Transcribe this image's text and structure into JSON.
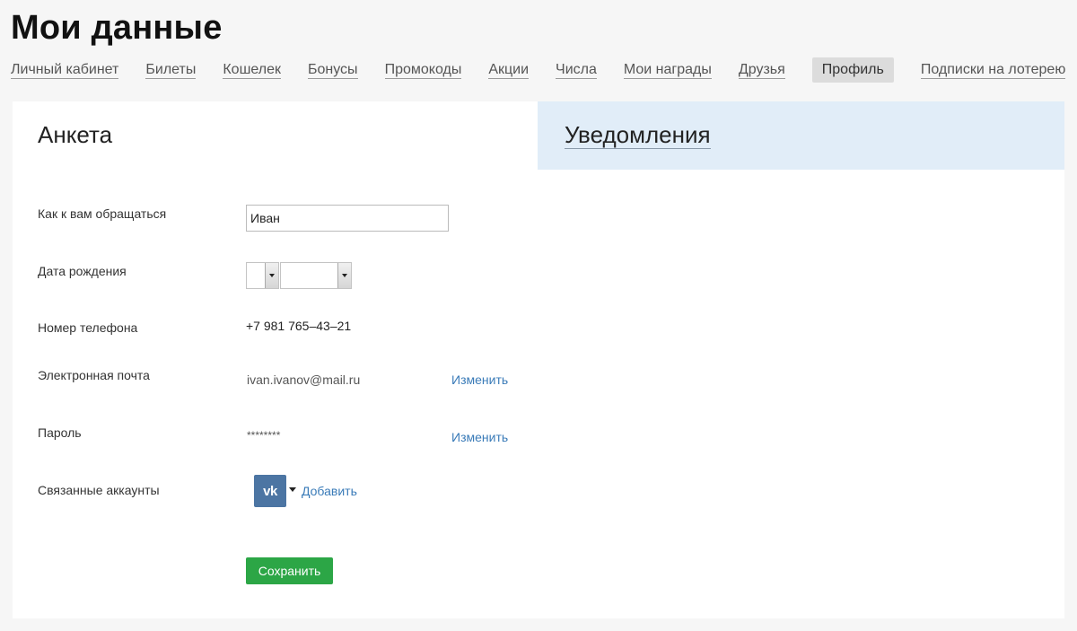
{
  "page": {
    "title": "Мои данные"
  },
  "nav": {
    "items": [
      {
        "label": "Личный кабинет"
      },
      {
        "label": "Билеты"
      },
      {
        "label": "Кошелек"
      },
      {
        "label": "Бонусы"
      },
      {
        "label": "Промокоды"
      },
      {
        "label": "Акции"
      },
      {
        "label": "Числа"
      },
      {
        "label": "Мои награды"
      },
      {
        "label": "Друзья"
      },
      {
        "label": "Профиль",
        "active": true
      },
      {
        "label": "Подписки на лотерею"
      }
    ]
  },
  "tabs": {
    "anketa": "Анкета",
    "notifications": "Уведомления"
  },
  "form": {
    "name": {
      "label": "Как к вам обращаться",
      "value": "Иван"
    },
    "birthdate": {
      "label": "Дата рождения",
      "day": "",
      "month": ""
    },
    "phone": {
      "label": "Номер телефона",
      "value": "+7 981 765–43–21"
    },
    "email": {
      "label": "Электронная почта",
      "value": "ivan.ivanov@mail.ru",
      "change": "Изменить"
    },
    "password": {
      "label": "Пароль",
      "value": "********",
      "change": "Изменить"
    },
    "accounts": {
      "label": "Связанные аккаунты",
      "vk": "vk",
      "add": "Добавить"
    },
    "save": "Сохранить"
  },
  "colors": {
    "background": "#f6f6f6",
    "notify_tab_bg": "#e1edf8",
    "link": "#3a7bb8",
    "save_button": "#2ca646",
    "vk": "#4c75a3"
  },
  "icons": [
    "vk-icon",
    "caret-down-icon",
    "select-arrow-icon"
  ]
}
